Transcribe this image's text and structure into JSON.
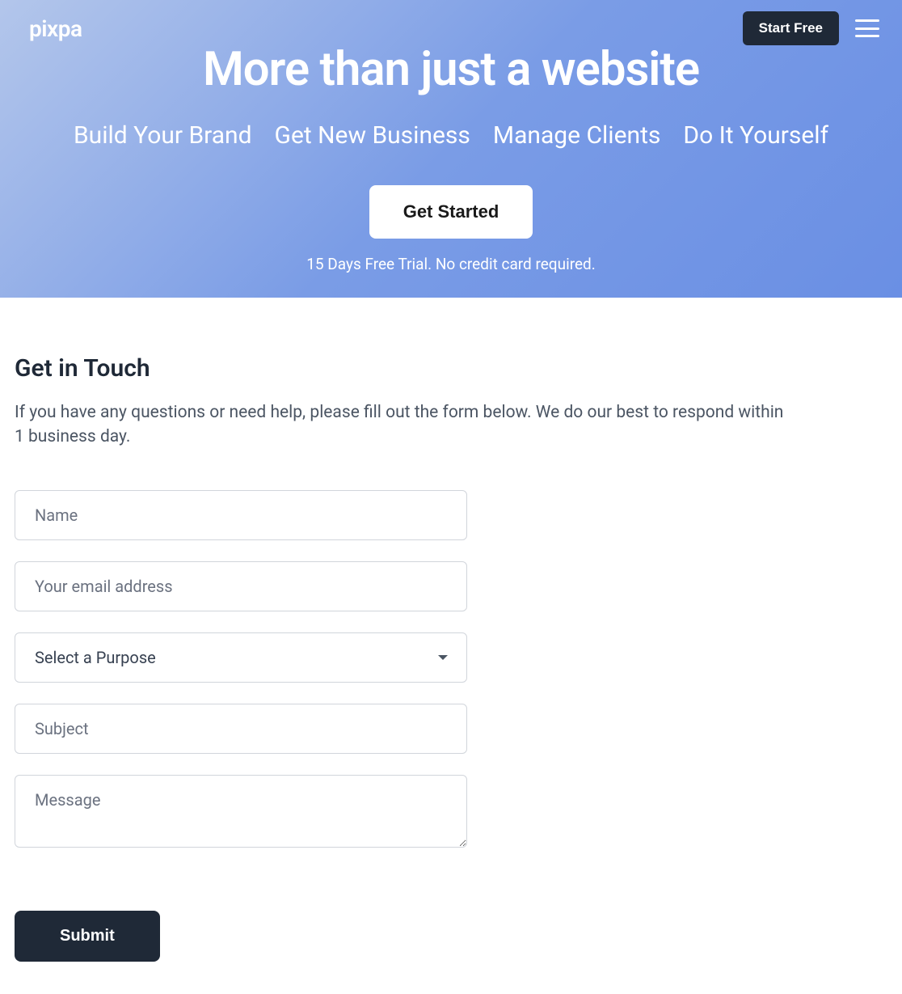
{
  "header": {
    "logo": "pixpa",
    "start_free_label": "Start Free"
  },
  "hero": {
    "title": "More than just a website",
    "benefits": [
      "Build Your Brand",
      "Get New Business",
      "Manage Clients",
      "Do It Yourself"
    ],
    "cta_label": "Get Started",
    "trial_note": "15 Days Free Trial. No credit card required."
  },
  "contact": {
    "title": "Get in Touch",
    "description": "If you have any questions or need help, please fill out the form below. We do our best to respond within 1 business day.",
    "form": {
      "name_placeholder": "Name",
      "email_placeholder": "Your email address",
      "purpose_placeholder": "Select a Purpose",
      "subject_placeholder": "Subject",
      "message_placeholder": "Message",
      "submit_label": "Submit"
    }
  }
}
